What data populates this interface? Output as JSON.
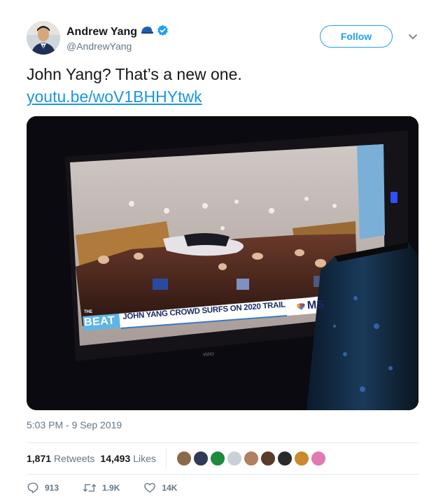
{
  "author": {
    "display_name": "Andrew Yang",
    "handle": "@AndrewYang",
    "follow_label": "Follow"
  },
  "tweet": {
    "text": "John Yang?  That’s a new one.",
    "link": "youtu.be/woV1BHHYtwk",
    "timestamp": "5:03 PM - 9 Sep 2019"
  },
  "media": {
    "tv_brand": "VIZIO",
    "show_name": "BEAT",
    "show_prefix": "THE",
    "chyron": "JOHN YANG CROWD SURFS ON 2020 TRAIL",
    "network": "MS"
  },
  "stats": {
    "retweets_count": "1,871",
    "retweets_label": "Retweets",
    "likes_count": "14,493",
    "likes_label": "Likes",
    "liker_avatars": [
      "#8a6a4a",
      "#2f3b55",
      "#1f8a3c",
      "#c9d1d8",
      "#b08060",
      "#5a3a2a",
      "#2a2a2a",
      "#c98a30",
      "#e07ab0"
    ]
  },
  "actions": {
    "replies": "913",
    "retweets": "1.9K",
    "likes": "14K"
  },
  "colors": {
    "accent": "#1da1f2",
    "link": "#1b95e0",
    "muted": "#657786"
  }
}
